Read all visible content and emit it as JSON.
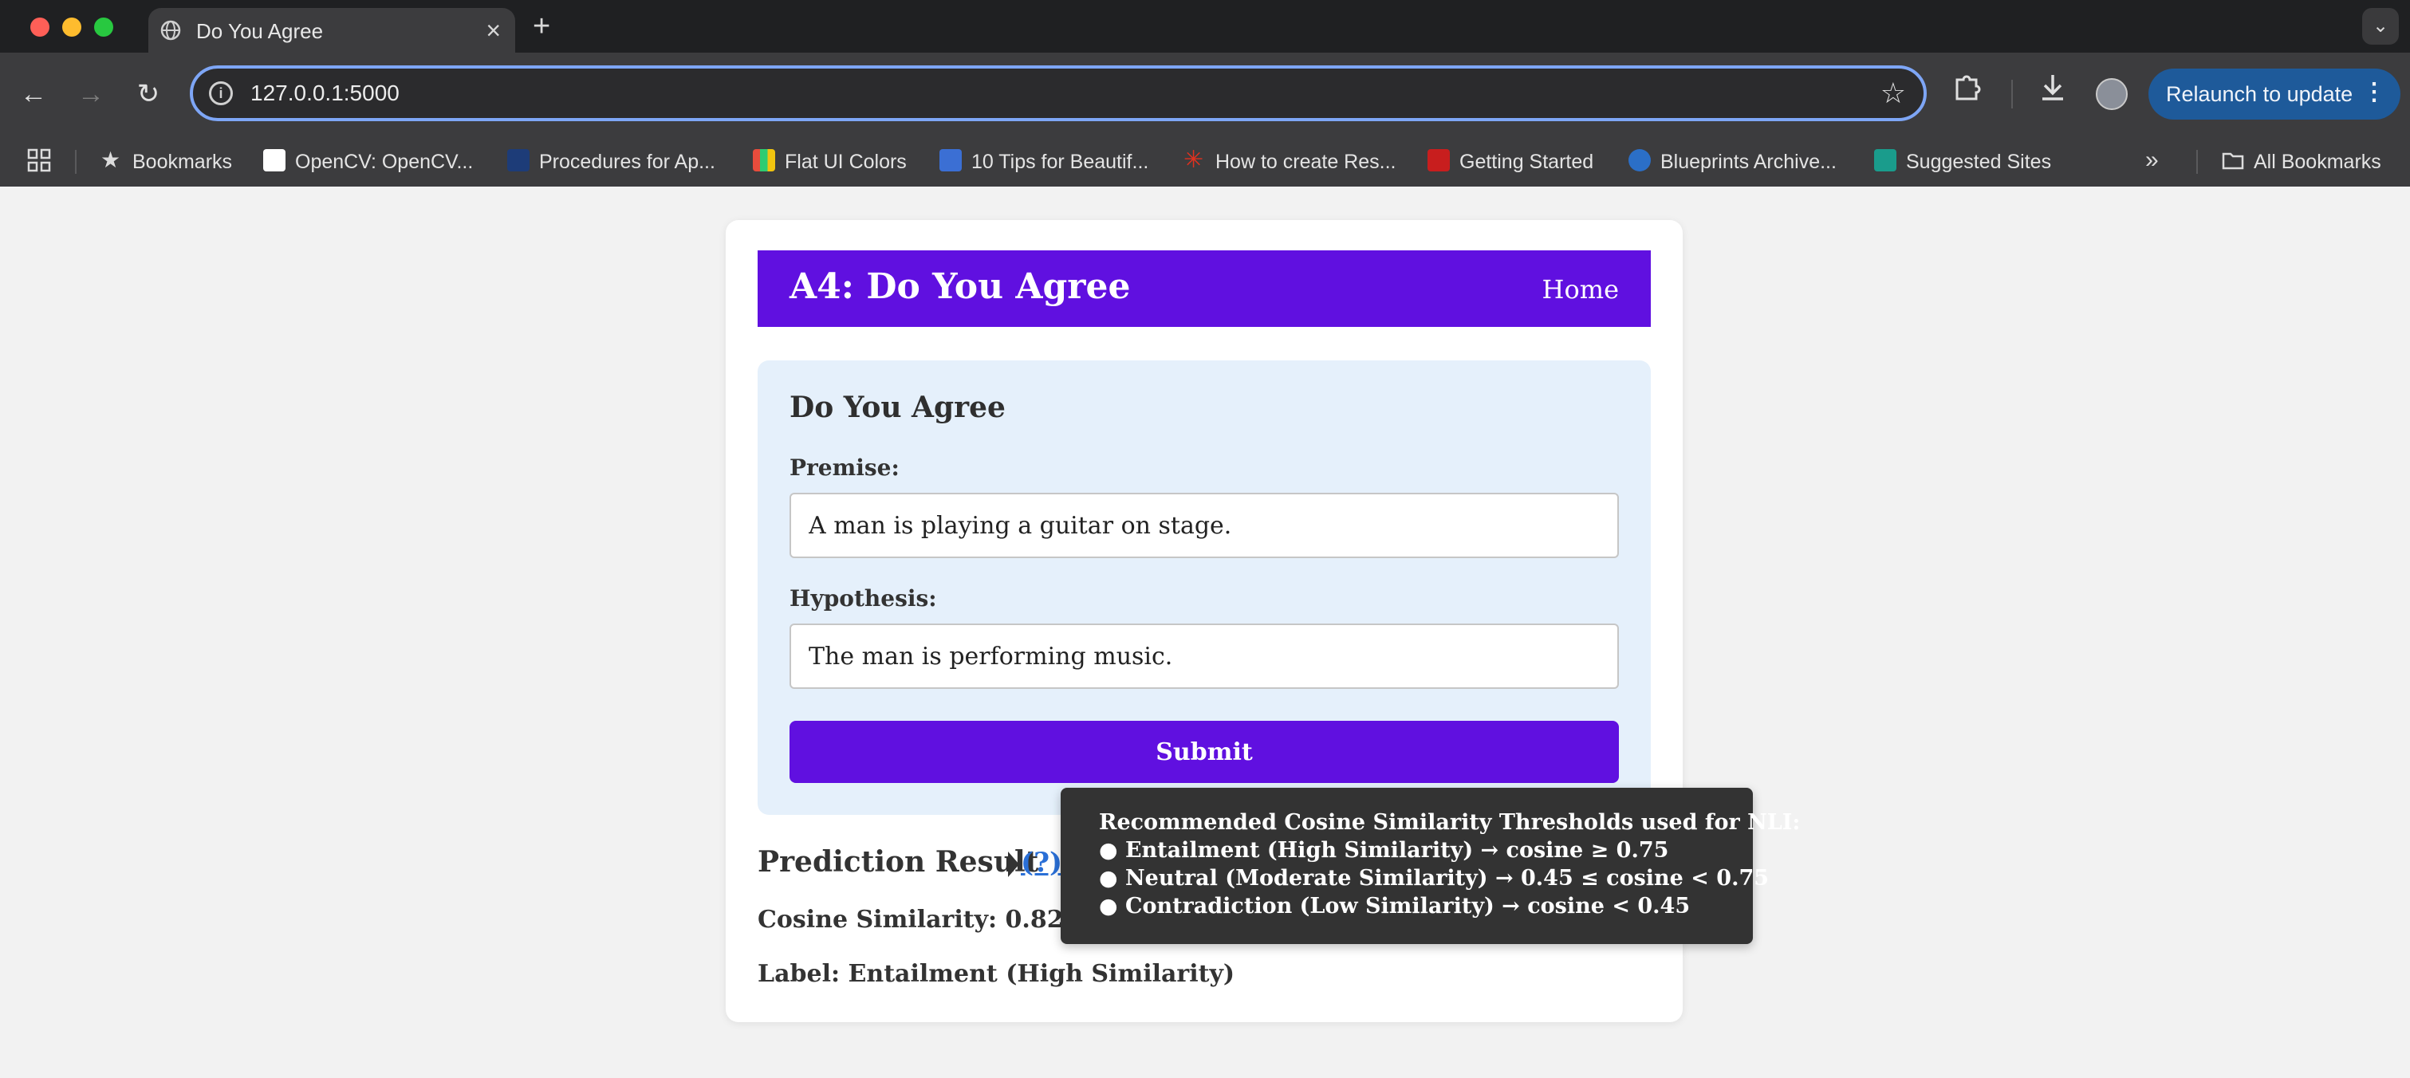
{
  "browser": {
    "tab_title": "Do You Agree",
    "tab_close": "×",
    "new_tab": "+",
    "tab_menu": "⌄",
    "url": "127.0.0.1:5000",
    "relaunch_label": "Relaunch to update",
    "relaunch_menu": "⋮",
    "bookmarks": [
      {
        "label": "Bookmarks",
        "icon": "star-icon"
      },
      {
        "label": "OpenCV: OpenCV...",
        "icon": "opencv-icon",
        "color": "#ffffff"
      },
      {
        "label": "Procedures for Ap...",
        "icon": "adb-icon",
        "color": "#1d3c78"
      },
      {
        "label": "Flat UI Colors",
        "icon": "flat-ui-icon",
        "color": "#e67e22"
      },
      {
        "label": "10 Tips for Beautif...",
        "icon": "tips-icon",
        "color": "#3b6fd4"
      },
      {
        "label": "How to create Res...",
        "icon": "asterisk-icon",
        "color": "#e0311f"
      },
      {
        "label": "Getting Started",
        "icon": "getting-started-icon",
        "color": "#c81e1e"
      },
      {
        "label": "Blueprints Archive...",
        "icon": "blueprints-icon",
        "color": "#2b6fc7"
      },
      {
        "label": "Suggested Sites",
        "icon": "bing-icon",
        "color": "#1a9c8c"
      }
    ],
    "all_bookmarks": "All Bookmarks",
    "more": "»"
  },
  "app": {
    "title": "A4: Do You Agree",
    "home_link": "Home"
  },
  "form": {
    "heading": "Do You Agree",
    "premise_label": "Premise:",
    "premise_value": "A man is playing a guitar on stage.",
    "hypothesis_label": "Hypothesis:",
    "hypothesis_value": "The man is performing music.",
    "submit_label": "Submit"
  },
  "result": {
    "heading": "Prediction Result",
    "help": "(?)",
    "cosine_line": "Cosine Similarity: 0.8229",
    "label_line": "Label: Entailment (High Similarity)"
  },
  "tooltip": {
    "title": "Recommended Cosine Similarity Thresholds used for NLI:",
    "lines": [
      "● Entailment (High Similarity) → cosine ≥ 0.75",
      "● Neutral (Moderate Similarity) → 0.45 ≤ cosine < 0.75",
      "● Contradiction (Low Similarity) → cosine < 0.45"
    ]
  },
  "colors": {
    "accent": "#6010e0",
    "panel": "#e5f0fb",
    "link": "#2a6fd6",
    "tooltip_bg": "#333333"
  }
}
